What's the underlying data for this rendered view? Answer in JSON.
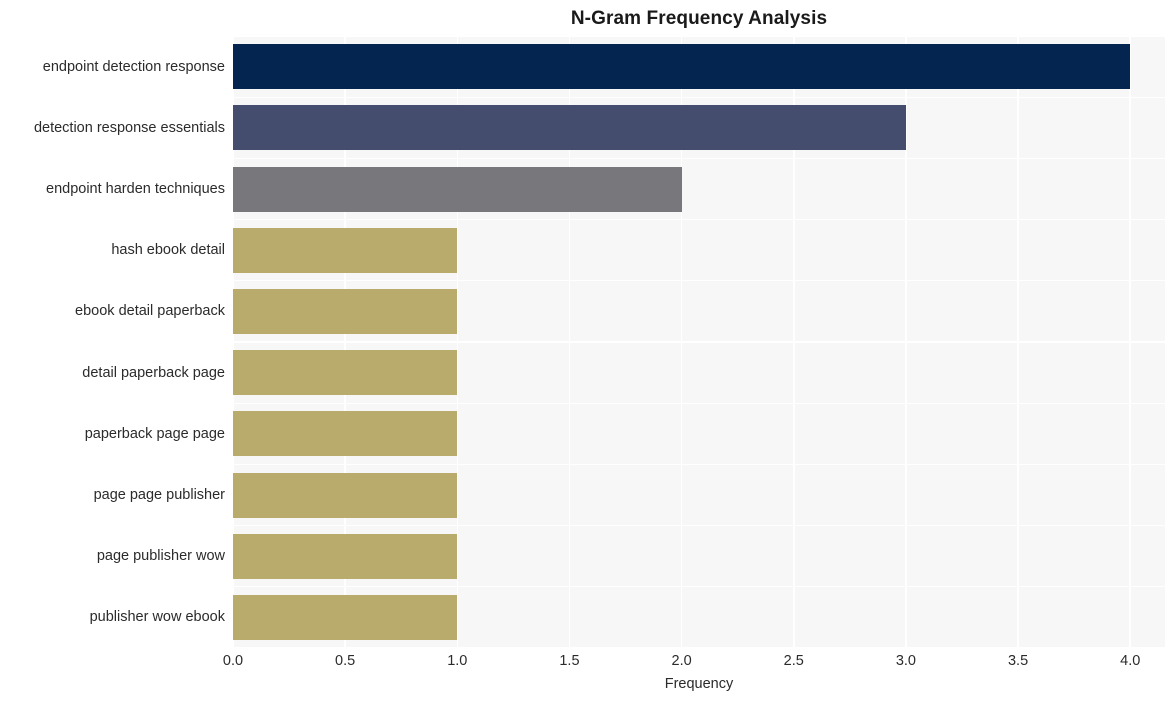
{
  "chart_data": {
    "type": "bar",
    "orientation": "horizontal",
    "title": "N-Gram Frequency Analysis",
    "xlabel": "Frequency",
    "ylabel": "",
    "categories": [
      "endpoint detection response",
      "detection response essentials",
      "endpoint harden techniques",
      "hash ebook detail",
      "ebook detail paperback",
      "detail paperback page",
      "paperback page page",
      "page page publisher",
      "page publisher wow",
      "publisher wow ebook"
    ],
    "values": [
      4,
      3,
      2,
      1,
      1,
      1,
      1,
      1,
      1,
      1
    ],
    "bar_colors": [
      "#04254f",
      "#444d6e",
      "#78777b",
      "#b8ab6c",
      "#b8ab6c",
      "#b8ab6c",
      "#b8ab6c",
      "#b8ab6c",
      "#b8ab6c",
      "#b8ab6c"
    ],
    "xlim": [
      0,
      4.155
    ],
    "xticks": [
      0,
      0.5,
      1,
      1.5,
      2,
      2.5,
      3,
      3.5,
      4
    ],
    "xtick_labels": [
      "0.0",
      "0.5",
      "1.0",
      "1.5",
      "2.0",
      "2.5",
      "3.0",
      "3.5",
      "4.0"
    ],
    "grid": true,
    "legend": "none",
    "plot_background": "#f7f7f8",
    "gridline_color": "#ffffff",
    "figure_background": "#ffffff",
    "text_color": "#2b2b2b",
    "title_color": "#1a1a1a"
  }
}
